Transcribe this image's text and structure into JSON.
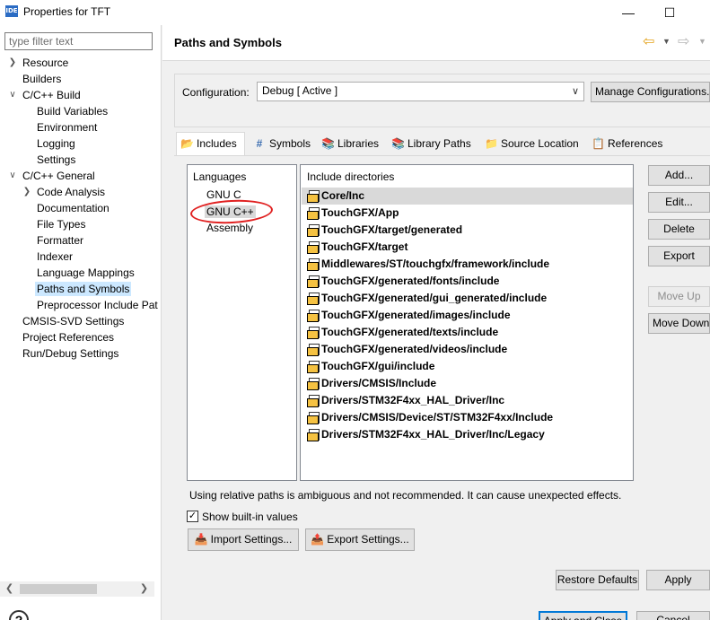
{
  "window": {
    "title": "Properties for TFT",
    "app_icon": "IDE"
  },
  "filter": {
    "placeholder": "type filter text"
  },
  "tree": [
    {
      "label": "Resource",
      "expander": "collapsed"
    },
    {
      "label": "Builders",
      "expander": "none"
    },
    {
      "label": "C/C++ Build",
      "expander": "expanded"
    },
    {
      "label": "Build Variables",
      "expander": "none"
    },
    {
      "label": "Environment",
      "expander": "none"
    },
    {
      "label": "Logging",
      "expander": "none"
    },
    {
      "label": "Settings",
      "expander": "none"
    },
    {
      "label": "C/C++ General",
      "expander": "expanded"
    },
    {
      "label": "Code Analysis",
      "expander": "collapsed"
    },
    {
      "label": "Documentation",
      "expander": "none"
    },
    {
      "label": "File Types",
      "expander": "none"
    },
    {
      "label": "Formatter",
      "expander": "none"
    },
    {
      "label": "Indexer",
      "expander": "none"
    },
    {
      "label": "Language Mappings",
      "expander": "none"
    },
    {
      "label": "Paths and Symbols",
      "expander": "none",
      "selected": true
    },
    {
      "label": "Preprocessor Include Pat",
      "expander": "none"
    },
    {
      "label": "CMSIS-SVD Settings",
      "expander": "none"
    },
    {
      "label": "Project References",
      "expander": "none"
    },
    {
      "label": "Run/Debug Settings",
      "expander": "none"
    }
  ],
  "header": {
    "title": "Paths and Symbols"
  },
  "config": {
    "label": "Configuration:",
    "value": "Debug  [ Active ]",
    "manage_label": "Manage Configurations..."
  },
  "tabs": [
    {
      "label": "Includes",
      "icon": "folder-includes-icon",
      "active": true
    },
    {
      "label": "Symbols",
      "icon": "hash-icon"
    },
    {
      "label": "Libraries",
      "icon": "books-icon"
    },
    {
      "label": "Library Paths",
      "icon": "library-path-icon"
    },
    {
      "label": "Source Location",
      "icon": "source-folder-icon"
    },
    {
      "label": "References",
      "icon": "references-icon"
    }
  ],
  "languages": {
    "header": "Languages",
    "items": [
      "GNU C",
      "GNU C++",
      "Assembly"
    ],
    "selected": "GNU C++"
  },
  "includes": {
    "header": "Include directories",
    "items": [
      "Core/Inc",
      "TouchGFX/App",
      "TouchGFX/target/generated",
      "TouchGFX/target",
      "Middlewares/ST/touchgfx/framework/include",
      "TouchGFX/generated/fonts/include",
      "TouchGFX/generated/gui_generated/include",
      "TouchGFX/generated/images/include",
      "TouchGFX/generated/texts/include",
      "TouchGFX/generated/videos/include",
      "TouchGFX/gui/include",
      "Drivers/CMSIS/Include",
      "Drivers/STM32F4xx_HAL_Driver/Inc",
      "Drivers/CMSIS/Device/ST/STM32F4xx/Include",
      "Drivers/STM32F4xx_HAL_Driver/Inc/Legacy"
    ],
    "selected_index": 0
  },
  "side_buttons": {
    "add": "Add...",
    "edit": "Edit...",
    "delete": "Delete",
    "export": "Export",
    "move_up": "Move Up",
    "move_down": "Move Down"
  },
  "note": "Using relative paths is ambiguous and not recommended. It can cause unexpected effects.",
  "show_builtin": {
    "label": "Show built-in values",
    "checked": true
  },
  "import_label": "Import Settings...",
  "export_label": "Export Settings...",
  "restore_label": "Restore Defaults",
  "apply_label": "Apply",
  "apply_close_label": "Apply and Close",
  "cancel_label": "Cancel",
  "colors": {
    "selection": "#cce8ff",
    "annotation": "#e02020",
    "back_arrow": "#e3a118"
  }
}
